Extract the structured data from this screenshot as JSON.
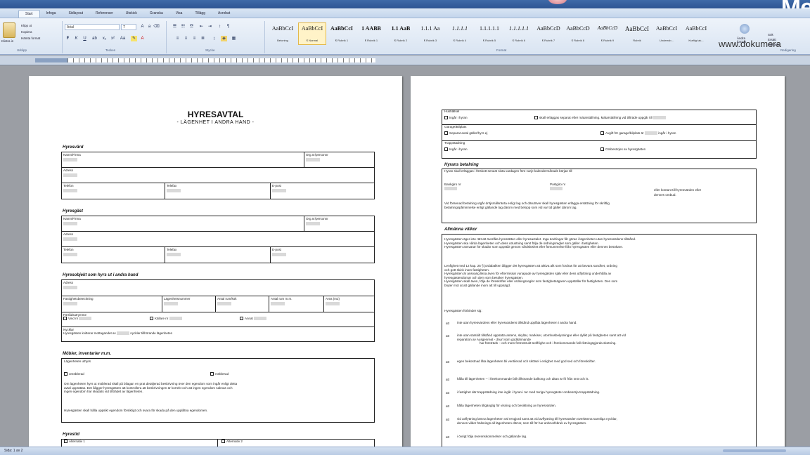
{
  "window": {
    "brand_fragment": "Me",
    "website": "www.dokumera"
  },
  "tabs": [
    "Start",
    "Infoga",
    "Sidlayout",
    "Referenser",
    "Utskick",
    "Granska",
    "Visa",
    "Tillägg",
    "Acrobat"
  ],
  "ribbon": {
    "paste_label": "Klistra in",
    "clipboard_items": [
      "Klipp ut",
      "Kopiera",
      "Hämta format"
    ],
    "font_name": "Arial",
    "font_size": "7",
    "group_labels": [
      "Urklipp",
      "Tecken",
      "Stycke",
      "Format",
      "Redigering"
    ],
    "styles": [
      {
        "preview": "AaBbCcI",
        "name": "Betoning"
      },
      {
        "preview": "AaBbCcI",
        "name": "¶ Normal"
      },
      {
        "preview": "AaBbCcI",
        "name": "¶ Rubrik 1"
      },
      {
        "preview": "1 AABB",
        "name": "¶ Rubrik 1"
      },
      {
        "preview": "1.1 AaB",
        "name": "¶ Rubrik 2"
      },
      {
        "preview": "1.1.1 Aa",
        "name": "¶ Rubrik 3"
      },
      {
        "preview": "1.1.1.1",
        "name": "¶ Rubrik 4"
      },
      {
        "preview": "1.1.1.1.1",
        "name": "¶ Rubrik 5"
      },
      {
        "preview": "1.1.1.1.1",
        "name": "¶ Rubrik 6"
      },
      {
        "preview": "AaBbCcD",
        "name": "¶ Rubrik 7"
      },
      {
        "preview": "AaBbCcD",
        "name": "¶ Rubrik 8"
      },
      {
        "preview": "AaBbCcD",
        "name": "¶ Rubrik 9"
      },
      {
        "preview": "AaBbCcI",
        "name": "Rubrik"
      },
      {
        "preview": "AaBbCcI",
        "name": "Underrub..."
      },
      {
        "preview": "AaBbCcI",
        "name": "Kraftigt ak..."
      }
    ],
    "change_styles": "Ändra format",
    "editing": [
      "Sök",
      "Ersätt",
      "Markera"
    ]
  },
  "page1": {
    "title": "HYRESAVTAL",
    "subtitle": "- LÄGENHET I ANDRA HAND -",
    "sections": {
      "hyresvard": "Hyresvärd",
      "hyresgast": "Hyresgäst",
      "lagenhet": "Hyresobjekt som hyrs ut i andra hand",
      "mobler": "Möbler, inventarier m.m.",
      "hyrestid": "Hyrestid"
    },
    "labels": {
      "namn": "Namn/Firma",
      "orgnr": "Org.nr/personnr",
      "adress": "Adress",
      "telefon": "Telefon",
      "telefax": "Telefax",
      "epost": "E-post",
      "fastighet": "Fastighetsbeteckning",
      "lagenhetsnr": "Lägenhetsnummer",
      "antal_rum": "Antal rum/kök",
      "antal_rum_tot": "Antal rum m.m.",
      "area": "Area (m2)",
      "forradsutrymme": "Förrådsutrymme",
      "vind": "Vind nr",
      "kallare": "Källare nr",
      "annat": "Annat",
      "nycklar": "Nycklar",
      "nycklar_text": "Hyresgästen kvitterar mottagandet av",
      "nycklar_text2": "nycklar tillhörande lägenheten",
      "lagenhet_uthyrs": "Lägenheten uthyrs",
      "omoblerad": "omöblerad",
      "moblerad": "möblerad",
      "inv_text1": "Om lägenheten hyrs ut möblerad skall på bilagan en prat detaljerad beskrivning över den egendom som ingår enligt detta",
      "inv_text2": "avtal upprättas. Det åligger hyresgästen att kontrollera att beskrivningen är korrekt och att ingen egendom saknas och",
      "inv_text3": "ingen egendom har skadats vid tillträdet av lägenheten.",
      "inv_text4": "Hyresgästen skall hålla uppsikt egendom försiktigt och svara för skada på den upplåtna egendomen.",
      "alt1": "Alternativ 1",
      "alt2": "Alternativ 2"
    }
  },
  "page2": {
    "hushallsel": "Hushållsel",
    "el_ingar": "Ingår i hyran",
    "el_separat": "skall erläggas separat efter mätarställning. Mätarställning vid tillträde uppgår till",
    "garage": "Garage/Bilplats",
    "garage_sep": "Separat avtal gäller/hyrs ej",
    "garage_avgift": "Avgift för garage/bilplats är",
    "garage_avgift2": "ingår i hyran",
    "trappstadning": "Trappstädning",
    "trapp_ingar": "Ingår i hyran",
    "trapp_ombes": "Ombesörjes av hyresgästen",
    "betalning_head": "Hyrans betalning",
    "betalning_text": "Hyran skall erläggas i förskott senast sista vardagen före varje kalendermånads början till",
    "bankgiro": "Bankgiro nr",
    "postgiro": "Postgiro nr",
    "eller": "eller kontant till hyresvärden eller",
    "dennes_ombud": "dennes ombud.",
    "forsenad": "Vid försenad betalning utgår dröjsmålsränta enligt lag och därutöver skall hyresgästen erlägga ersättning för skriftlig",
    "forsenad2": "betalningspåminnelse enligt gällande lag därom med belopp som vid var tid gäller därom lag.",
    "allm_head": "Allmänna villkor",
    "allm": [
      "Hyresgästen äger inte rätt att överlåta hyresrätten eller hyresavtalet. Inga ändringar får göras i lägenheten utan hyresvärdens tillstånd.",
      "Hyresgästen ska vårda lägenheten och dess utrustning samt följa de ordningsregler som gäller i fastigheten.",
      "Hyresgästen ansvarar för skador som uppstår genom vårdslöshet eller försummelse från hyresgästen eller dennes besökare."
    ],
    "para2": [
      "Lenfighet med 12 kap. 25 § jordabalken åligger det hyresgästen att aktiva allt som fordras för att bevara sundhet, ordning",
      "och gott skick inom fastigheten.",
      "Hyresgästen är ansvarig liksa även för eftermissar vunapade av hyresgästen själv eller dess utflyttning underhålla av",
      "hyresgästendomar och dem som besöker hyresgästen.",
      "Hyresgästen skall även, följa de föreskrifter eller ordningsregler som fastighetsägaren uppställer för fastigheten. Den som",
      "bryter mot at att gällande inom att till uppsägd."
    ],
    "forbinder": "Hyresgästen förbinder sig:",
    "att_items": [
      "inte utan hyresvärdens eller hyresvärdens tillstånd upplåta lägenheten i andra hand.",
      "inte utan särskilt tillstånd uppsätta antenn, skyltar, markiser, utomhusbelysningar eller dylikt på fastigheten samt att vid",
      "egen bekostnad låta lägenheten bli ventilerad och skötsel i enlighet med god sed och föreskrifter.",
      "hålla till lägenheten -- i förekommande fall tillhörande balkong och altan är fri från snö och is.",
      "i fastighet där trappstädning inte ingår i hyran i tur med övriga hyresgäster ombesörja trappstädning.",
      "hålla lägenheten tillgänglig för visning och besiktning av hyresvärden.",
      "vid avflyttning lämna lägenheten väl rengjord samt att vid avflyttning till hyresvärden överlämna samtliga nycklar,",
      "i övrigt följa överenskommelser och gällande lag."
    ],
    "att_word": "att",
    "att_sub1a": "reparation av Ausgenreat - dnurt som godkännande",
    "att_sub1b": "har företräds – och mom fretrostrukt teoffrighe och i förekommande fall riktningsgjorda skotning.",
    "att_sub6": "dennes vilder hälsnings all lägenheten dörrar, som till för har anbrunfsbruk av hyresgästen."
  },
  "status": {
    "page": "Sida: 1 av 2"
  }
}
